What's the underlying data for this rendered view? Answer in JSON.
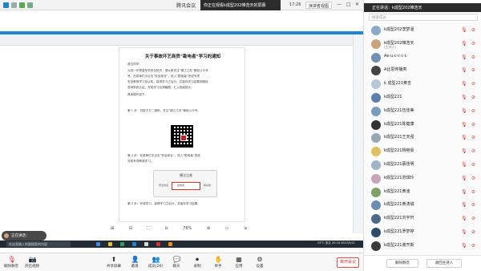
{
  "window": {
    "title": "腾讯会议",
    "banner": "你正在观看k成型202帷浩天的屏幕",
    "time": "17:26",
    "view_label": "演讲者视图",
    "minimize": "—",
    "maximize": "□",
    "close": "✕"
  },
  "document": {
    "title": "关于事故环艺商员“勘电者”学习的通知",
    "salutation": "各位同学：",
    "lines": [
      "为进一步提高专项安全知识，请大家关注“绵江江苏”微信公众号",
      "号，在菜单栏中点击“安全综合”，进入“勘电者”完成专项",
      "安全教育学习及认知，赢得学习之后分，并保存学习结果到微信",
      "咨询系统认证，完成学习后请截图，汇入班级统计。",
      "具体操作如下：",
      "第 1 步：扫描下方二维码，关注“绵江江苏”微信公众号。",
      "第 2 步：在菜单栏中点击“安全综合”，进入“勘电者”完成",
      "完成专项教育学习。",
      "第 3 步：完成学习，赢得学习之后分，并保存学习结果。"
    ],
    "phone_title": "绵江江苏",
    "phone_items": [
      "安全综合",
      "勘电者",
      "联系我"
    ]
  },
  "viewer_toolbar": {
    "zoom": "78%",
    "items": [
      "⊞",
      "⊟",
      "⛶",
      "⊖",
      "⊕",
      "▭",
      "⇲"
    ]
  },
  "speaker_bubble": "正在讲话：",
  "taskbar": {
    "search_placeholder": "在这里输入你要搜索的内容",
    "tray": "22°C 多云  20:16  2022/9/21"
  },
  "bottom_toolbar": {
    "items": [
      {
        "label": "解除静音",
        "icon": "🎙",
        "red": true
      },
      {
        "label": "开启视频",
        "icon": "📷",
        "red": true
      },
      {
        "label": "共享屏幕",
        "icon": "⬆",
        "red": false
      },
      {
        "label": "邀请",
        "icon": "👤",
        "red": false
      },
      {
        "label": "成员(26)",
        "icon": "👥",
        "red": false
      },
      {
        "label": "聊天",
        "icon": "💬",
        "red": false
      },
      {
        "label": "录制",
        "icon": "⏺",
        "red": false
      },
      {
        "label": "举手",
        "icon": "✋",
        "red": false
      },
      {
        "label": "应用",
        "icon": "▦",
        "red": false
      },
      {
        "label": "设置",
        "icon": "⚙",
        "red": false
      }
    ],
    "leave_label": "离开会议"
  },
  "participants": {
    "title": "成员(26)",
    "banner": "正在讲话：k成型202帷浩天",
    "search_placeholder": "搜索成员",
    "members": [
      {
        "name": "k成型202李梦涵",
        "role": "",
        "color": "#8aa9c7"
      },
      {
        "name": "k成型202帷浩天",
        "role": "(主持人)",
        "color": "#c9a37a"
      },
      {
        "name": "Ae·u·c·c·c·c",
        "role": "",
        "color": "#6f8fb3"
      },
      {
        "name": "A比思传播类",
        "role": "",
        "color": "#444444"
      },
      {
        "name": "k 成型221黄吉",
        "role": "",
        "color": "#b8c7d6"
      },
      {
        "name": "k成型221",
        "role": "",
        "color": "#5a7fa8"
      },
      {
        "name": "k成型221伍佳美",
        "role": "",
        "color": "#7b9cc2"
      },
      {
        "name": "k成型221陈健康",
        "role": "",
        "color": "#333333"
      },
      {
        "name": "k成型221王天强",
        "role": "",
        "color": "#9aa7b2"
      },
      {
        "name": "k成型221杨继豪",
        "role": "",
        "color": "#e0c060"
      },
      {
        "name": "k成型221蔡佳明",
        "role": "",
        "color": "#a0b4c8"
      },
      {
        "name": "k成型221范琪玲",
        "role": "",
        "color": "#c9a3b8"
      },
      {
        "name": "k成型221黄凌",
        "role": "",
        "color": "#7fa067"
      },
      {
        "name": "k成型221黄涛诚",
        "role": "",
        "color": "#6d8db0"
      },
      {
        "name": "k成型221刘宇轩",
        "role": "",
        "color": "#4a6a8a"
      },
      {
        "name": "k成型221罗梦婷",
        "role": "",
        "color": "#2e4b6a"
      },
      {
        "name": "k成型221谢开斯",
        "role": "",
        "color": "#3a3a3a"
      }
    ],
    "unmute_all": "解除静音",
    "transfer_host": "收回主持人"
  }
}
